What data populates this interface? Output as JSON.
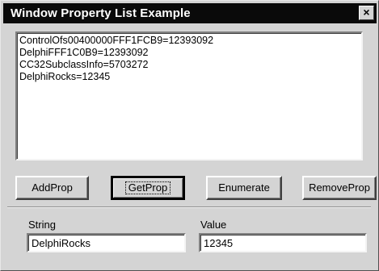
{
  "window": {
    "title": "Window Property List Example",
    "close_glyph": "×"
  },
  "list": {
    "items": [
      "ControlOfs00400000FFF1FCB9=12393092",
      "DelphiFFF1C0B9=12393092",
      "CC32SubclassInfo=5703272",
      "DelphiRocks=12345"
    ]
  },
  "buttons": {
    "add": "AddProp",
    "get": "GetProp",
    "enumerate": "Enumerate",
    "remove": "RemoveProp"
  },
  "fields": {
    "string_label": "String",
    "string_value": "DelphiRocks",
    "value_label": "Value",
    "value_value": "12345"
  },
  "colors": {
    "titlebar": "#0a0a0a",
    "face": "#d4d4d4"
  }
}
